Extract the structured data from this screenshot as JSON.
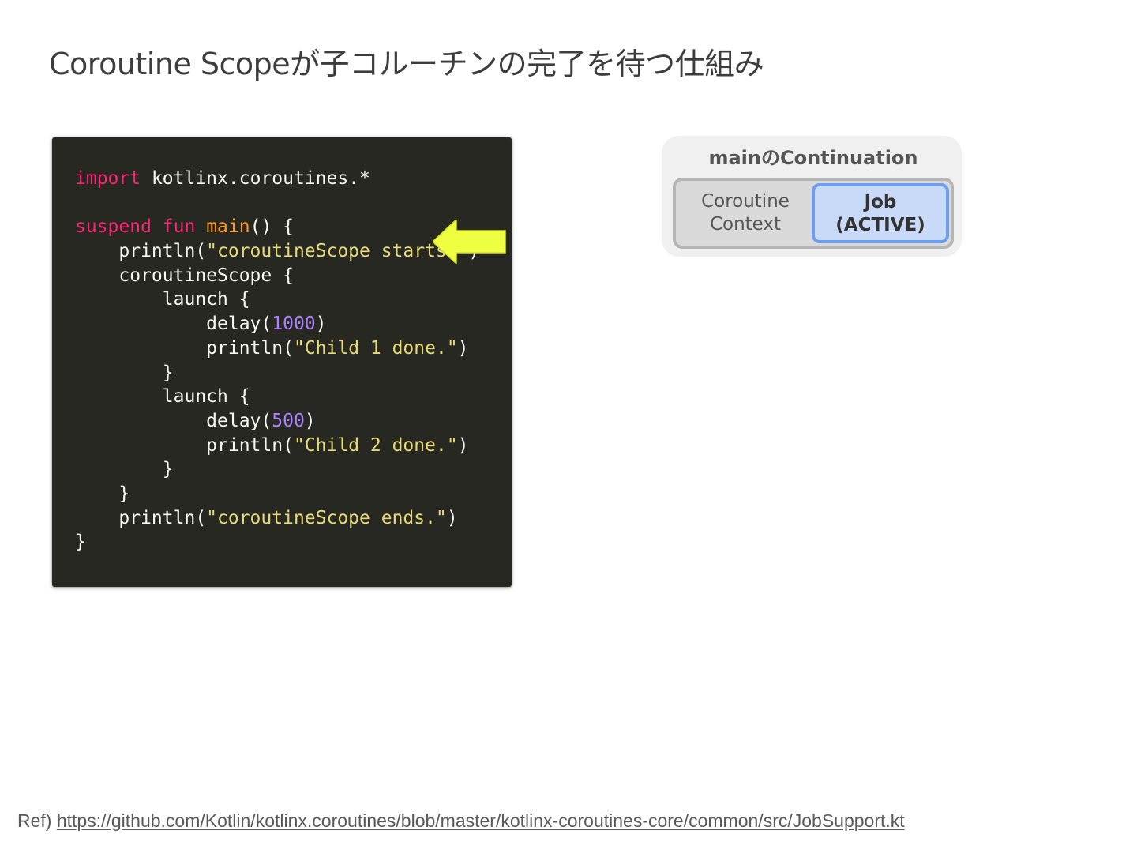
{
  "title": "Coroutine Scopeが子コルーチンの完了を待つ仕組み",
  "code": {
    "language": "kotlin",
    "lines": [
      [
        {
          "t": "import",
          "c": "kw"
        },
        {
          "t": " kotlinx.coroutines.*",
          "c": ""
        }
      ],
      [],
      [
        {
          "t": "suspend",
          "c": "kw"
        },
        {
          "t": " ",
          "c": ""
        },
        {
          "t": "fun",
          "c": "kw"
        },
        {
          "t": " ",
          "c": ""
        },
        {
          "t": "main",
          "c": "fn"
        },
        {
          "t": "() {",
          "c": ""
        }
      ],
      [
        {
          "t": "    println(",
          "c": ""
        },
        {
          "t": "\"coroutineScope starts.\"",
          "c": "str"
        },
        {
          "t": ")",
          "c": ""
        }
      ],
      [
        {
          "t": "    coroutineScope {",
          "c": ""
        }
      ],
      [
        {
          "t": "        launch {",
          "c": ""
        }
      ],
      [
        {
          "t": "            delay(",
          "c": ""
        },
        {
          "t": "1000",
          "c": "num"
        },
        {
          "t": ")",
          "c": ""
        }
      ],
      [
        {
          "t": "            println(",
          "c": ""
        },
        {
          "t": "\"Child 1 done.\"",
          "c": "str"
        },
        {
          "t": ")",
          "c": ""
        }
      ],
      [
        {
          "t": "        }",
          "c": ""
        }
      ],
      [
        {
          "t": "        launch {",
          "c": ""
        }
      ],
      [
        {
          "t": "            delay(",
          "c": ""
        },
        {
          "t": "500",
          "c": "num"
        },
        {
          "t": ")",
          "c": ""
        }
      ],
      [
        {
          "t": "            println(",
          "c": ""
        },
        {
          "t": "\"Child 2 done.\"",
          "c": "str"
        },
        {
          "t": ")",
          "c": ""
        }
      ],
      [
        {
          "t": "        }",
          "c": ""
        }
      ],
      [
        {
          "t": "    }",
          "c": ""
        }
      ],
      [
        {
          "t": "    println(",
          "c": ""
        },
        {
          "t": "\"coroutineScope ends.\"",
          "c": "str"
        },
        {
          "t": ")",
          "c": ""
        }
      ],
      [
        {
          "t": "}",
          "c": ""
        }
      ]
    ],
    "highlight_line": 3,
    "arrow_color": "#eeff41"
  },
  "continuation": {
    "title": "mainのContinuation",
    "context_label_line1": "Coroutine",
    "context_label_line2": "Context",
    "job_label_line1": "Job",
    "job_label_line2": "(ACTIVE)"
  },
  "ref": {
    "prefix": "Ref)",
    "url": "https://github.com/Kotlin/kotlinx.coroutines/blob/master/kotlinx-coroutines-core/common/src/JobSupport.kt"
  },
  "colors": {
    "code_bg": "#272822",
    "keyword": "#f92672",
    "function": "#fd971f",
    "string": "#e6db74",
    "number": "#ae81ff",
    "job_fill": "#c9daf8",
    "job_border": "#6d9eeb"
  }
}
